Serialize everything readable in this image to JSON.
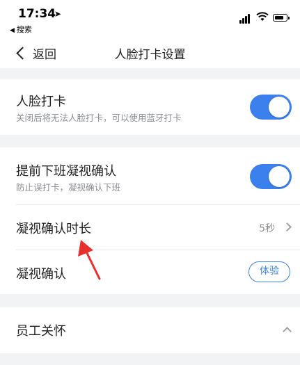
{
  "status_bar": {
    "time": "17:34",
    "back_to_app": "搜索"
  },
  "nav": {
    "back_label": "返回",
    "title": "人脸打卡设置"
  },
  "face_clockin": {
    "title": "人脸打卡",
    "subtitle": "关闭后将无法人脸打卡，可以使用蓝牙打卡",
    "enabled": true
  },
  "early_leave": {
    "title": "提前下班凝视确认",
    "subtitle": "防止误打卡，凝视确认下班",
    "enabled": true
  },
  "gaze_duration": {
    "title": "凝视确认时长",
    "value": "5秒"
  },
  "gaze_confirm": {
    "title": "凝视确认",
    "button_label": "体验"
  },
  "employee_care": {
    "title": "员工关怀"
  },
  "colors": {
    "accent": "#3b80ec",
    "background": "#f2f3f5",
    "annotation_arrow": "#e8312f"
  }
}
